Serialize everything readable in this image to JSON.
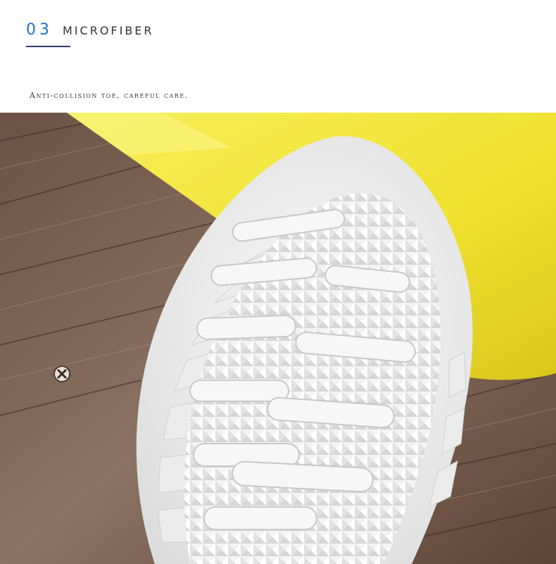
{
  "section": {
    "number": "03",
    "title": "MICROFIBER",
    "subtitle": "Anti-collision toe, careful care."
  },
  "photo": {
    "description_icon": "insole-photo",
    "colors": {
      "wood_dark": "#5a4133",
      "wood_light": "#9b8575",
      "insole_yellow": "#f3e63c",
      "sole_white": "#f2f2f2",
      "accent": "#1f6fd1"
    }
  }
}
